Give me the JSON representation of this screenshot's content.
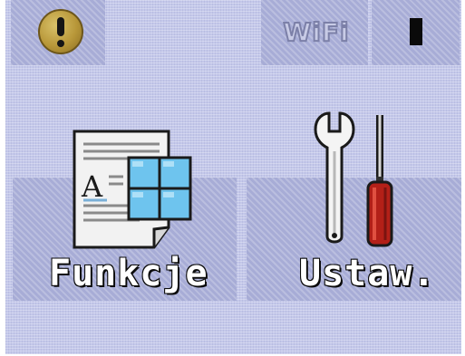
{
  "status_bar": {
    "alert_icon": "exclamation-alert-icon",
    "wifi_label": "WiFi",
    "ink_icon": "ink-level-icon"
  },
  "menu": {
    "items": [
      {
        "label": "Funkcje",
        "icon": "document-grid-icon"
      },
      {
        "label": "Ustaw.",
        "icon": "wrench-screwdriver-icon"
      }
    ]
  },
  "colors": {
    "screen_background": "#c4c8ea",
    "tile_background": "#a7acd6",
    "alert_gold": "#b89739",
    "screwdriver_red": "#b32018"
  }
}
